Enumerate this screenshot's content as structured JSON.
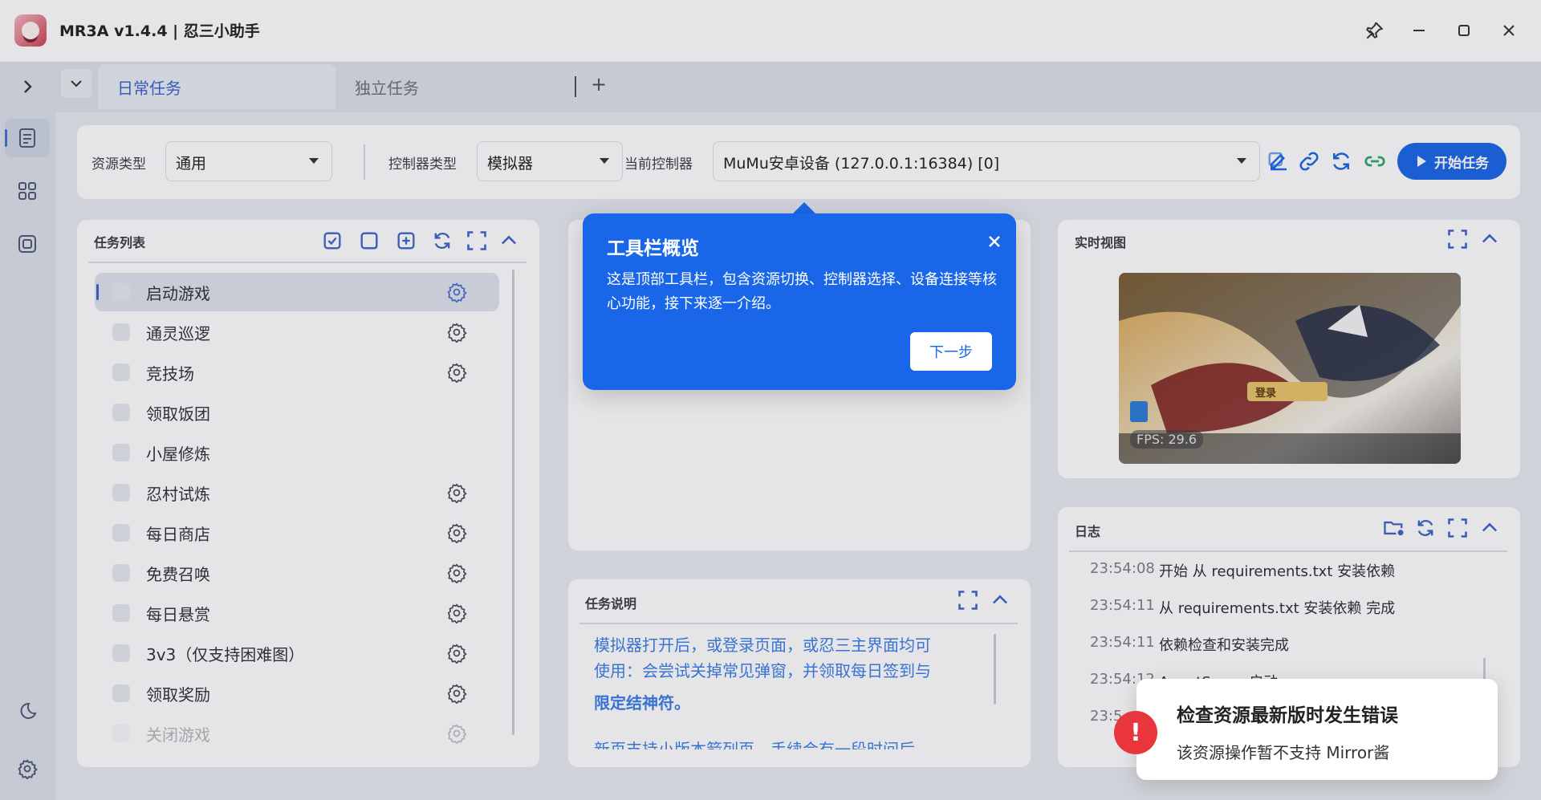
{
  "window": {
    "title": "MR3A v1.4.4 | 忍三小助手"
  },
  "tabs": {
    "items": [
      {
        "label": "日常任务",
        "active": true
      },
      {
        "label": "独立任务",
        "active": false
      }
    ],
    "add_label": "+"
  },
  "toolbar": {
    "resource_type_label": "资源类型",
    "resource_type_value": "通用",
    "controller_type_label": "控制器类型",
    "controller_type_value": "模拟器",
    "current_controller_label": "当前控制器",
    "current_controller_value": "MuMu安卓设备 (127.0.0.1:16384) [0]",
    "start_label": "开始任务"
  },
  "task_list": {
    "title": "任务列表",
    "items": [
      {
        "label": "启动游戏",
        "has_settings": true
      },
      {
        "label": "通灵巡逻",
        "has_settings": true
      },
      {
        "label": "竞技场",
        "has_settings": true
      },
      {
        "label": "领取饭团",
        "has_settings": false
      },
      {
        "label": "小屋修炼",
        "has_settings": false
      },
      {
        "label": "忍村试炼",
        "has_settings": true
      },
      {
        "label": "每日商店",
        "has_settings": true
      },
      {
        "label": "免费召唤",
        "has_settings": true
      },
      {
        "label": "每日悬赏",
        "has_settings": true
      },
      {
        "label": "3v3（仅支持困难图）",
        "has_settings": true
      },
      {
        "label": "领取奖励",
        "has_settings": true
      },
      {
        "label": "关闭游戏",
        "has_settings": true
      }
    ]
  },
  "task_description": {
    "title": "任务说明",
    "line1": "模拟器打开后，或登录页面，或忍三主界面均可",
    "line2": "使用：会尝试关掉常见弹窗，并领取每日签到与",
    "line3": "限定结神符。",
    "line4": "新页支持小版本箭列页，手续会有一段时间后"
  },
  "live_view": {
    "title": "实时视图",
    "fps": "FPS: 29.6",
    "login_label": "登录"
  },
  "log": {
    "title": "日志",
    "entries": [
      {
        "time": "23:54:08",
        "text": "开始 从 requirements.txt 安装依赖"
      },
      {
        "time": "23:54:11",
        "text": "从 requirements.txt 安装依赖 完成"
      },
      {
        "time": "23:54:11",
        "text": "依赖检查和安装完成"
      },
      {
        "time": "23:54:12",
        "text": "AgentServer启动"
      },
      {
        "time": "23:5",
        "text": ""
      }
    ]
  },
  "tour": {
    "title": "工具栏概览",
    "body": "这是顶部工具栏，包含资源切换、控制器选择、设备连接等核心功能，接下来逐一介绍。",
    "next_label": "下一步"
  },
  "toast": {
    "title": "检查资源最新版时发生错误",
    "message": "该资源操作暂不支持 Mirror酱",
    "icon_text": "!"
  },
  "colors": {
    "accent": "#1a66e8",
    "tab_active": "#3d63c9",
    "error": "#e8363c",
    "connect_green": "#2aa86a"
  }
}
